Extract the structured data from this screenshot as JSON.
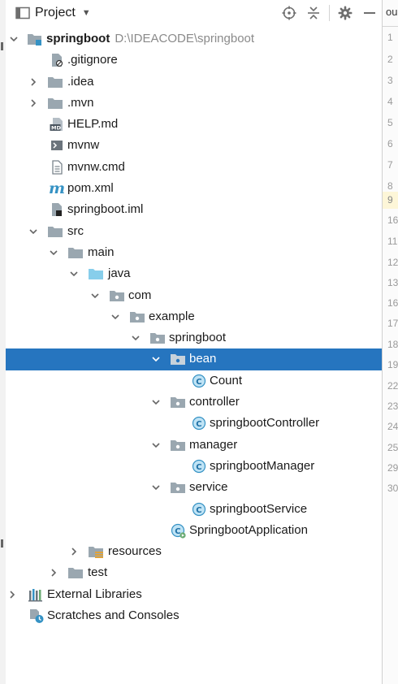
{
  "header": {
    "title": "Project"
  },
  "project": {
    "name": "springboot",
    "path": "D:\\IDEACODE\\springboot"
  },
  "tree": {
    "gitignore": ".gitignore",
    "idea": ".idea",
    "mvn": ".mvn",
    "help": "HELP.md",
    "mvnw": "mvnw",
    "mvnwcmd": "mvnw.cmd",
    "pom": "pom.xml",
    "iml": "springboot.iml",
    "src": "src",
    "main": "main",
    "java": "java",
    "com": "com",
    "example": "example",
    "springbootpkg": "springboot",
    "bean": "bean",
    "count": "Count",
    "controller": "controller",
    "controllerclass": "springbootController",
    "manager": "manager",
    "managerclass": "springbootManager",
    "service": "service",
    "serviceclass": "springbootService",
    "app": "SpringbootApplication",
    "resources": "resources",
    "test": "test",
    "extlib": "External Libraries",
    "scratches": "Scratches and Consoles"
  },
  "editor": {
    "tab_fragment": "ourc",
    "line_numbers": [
      "1",
      "2",
      "3",
      "4",
      "5",
      "6",
      "7",
      "8",
      "9",
      "16",
      "11",
      "12",
      "13",
      "16",
      "17",
      "18",
      "19",
      "22",
      "23",
      "24",
      "25",
      "29",
      "30"
    ]
  },
  "colors": {
    "selection": "#2675bf",
    "package_icon": "#9aa7b0",
    "class_icon": "#3592c4",
    "folder_icon": "#aebecb",
    "source_folder_icon": "#87ceeb",
    "caret_line": "#fdf6d8"
  }
}
